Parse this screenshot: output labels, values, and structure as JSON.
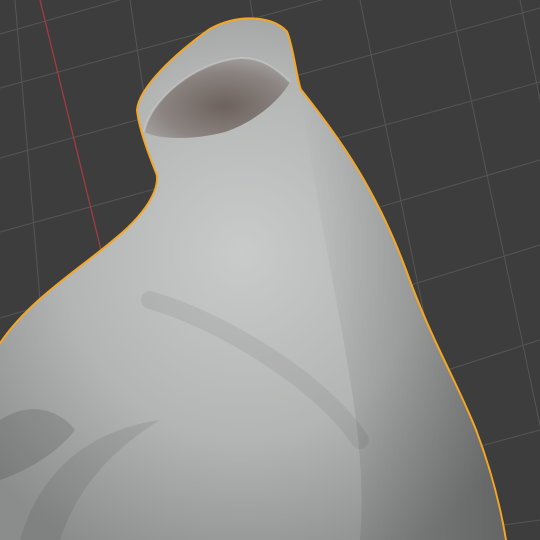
{
  "viewport": {
    "background_color": "#3d3d3d",
    "grid_line_color": "#555555",
    "axis_line_color": "#a33a45",
    "selection_outline_color": "#f5a623",
    "object_selected": true,
    "object_shading": "solid",
    "object_base_color": "#b7b9b8"
  }
}
